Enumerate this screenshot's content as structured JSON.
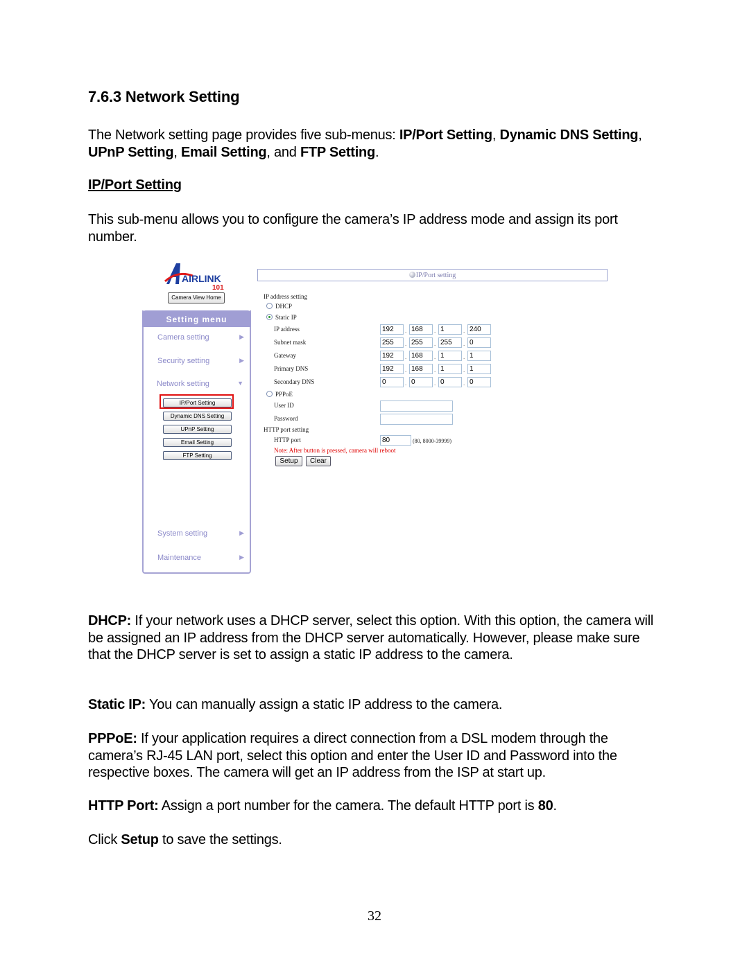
{
  "heading": "7.6.3 Network Setting",
  "intro": {
    "t1": "The Network setting page provides five sub-menus: ",
    "b1": "IP/Port Setting",
    "t2": ", ",
    "b2": "Dynamic DNS Setting",
    "t3": ", ",
    "b3": "UPnP Setting",
    "t4": ", ",
    "b4": "Email Setting",
    "t5": ", and ",
    "b5": "FTP Setting",
    "t6": "."
  },
  "subheading": "IP/Port Setting",
  "subintro": "This sub-menu allows you to configure the camera’s IP address mode and assign its port number.",
  "screenshot": {
    "logo_text": "AIRLINK",
    "logo_num": "101",
    "camera_view_home": "Camera View Home",
    "setting_menu": "Setting menu",
    "menu": [
      {
        "label": "Camera setting",
        "arrow": "▶"
      },
      {
        "label": "Security setting",
        "arrow": "▶"
      },
      {
        "label": "Network setting",
        "arrow": "▼"
      },
      {
        "label": "System setting",
        "arrow": "▶"
      },
      {
        "label": "Maintenance",
        "arrow": "▶"
      }
    ],
    "submenu": [
      "IP/Port Setting",
      "Dynamic DNS Setting",
      "UPnP Setting",
      "Email Setting",
      "FTP Setting"
    ],
    "panel_title": "IP/Port setting",
    "ip_address_setting": "IP address setting",
    "dhcp": "DHCP",
    "static_ip": "Static IP",
    "selected_mode": "Static IP",
    "rows": [
      {
        "label": "IP address",
        "values": [
          "192",
          "168",
          "1",
          "240"
        ]
      },
      {
        "label": "Subnet mask",
        "values": [
          "255",
          "255",
          "255",
          "0"
        ]
      },
      {
        "label": "Gateway",
        "values": [
          "192",
          "168",
          "1",
          "1"
        ]
      },
      {
        "label": "Primary DNS",
        "values": [
          "192",
          "168",
          "1",
          "1"
        ]
      },
      {
        "label": "Secondary DNS",
        "values": [
          "0",
          "0",
          "0",
          "0"
        ]
      }
    ],
    "dot": ".",
    "pppoe": "PPPoE",
    "user_id": "User ID",
    "password": "Password",
    "user_id_value": "",
    "password_value": "",
    "http_port_setting": "HTTP port setting",
    "http_port": "HTTP port",
    "http_port_value": "80",
    "http_port_range": "(80, 8000-39999)",
    "note": "Note: After button is pressed, camera will reboot",
    "setup": "Setup",
    "clear": "Clear"
  },
  "descriptions": {
    "dhcp_label": "DHCP:",
    "dhcp_text": " If your network uses a DHCP server, select this option. With this option, the camera will be assigned an IP address from the DHCP server automatically. However, please make sure that the DHCP server is set to assign a static IP address to the camera.",
    "static_label": "Static IP:",
    "static_text": " You can manually assign a static IP address to the camera.",
    "pppoe_label": "PPPoE:",
    "pppoe_text": " If your application requires a direct connection from a DSL modem through the camera’s RJ-45 LAN port, select this option and enter the User ID and Password into the respective boxes. The camera will get an IP address from the ISP at start up.",
    "http_label": "HTTP Port:",
    "http_text": " Assign a port number for the camera. The default HTTP port is ",
    "http_default": "80",
    "http_end": ".",
    "click_pre": "Click ",
    "click_bold": "Setup",
    "click_post": " to save the settings."
  },
  "page_number": "32"
}
